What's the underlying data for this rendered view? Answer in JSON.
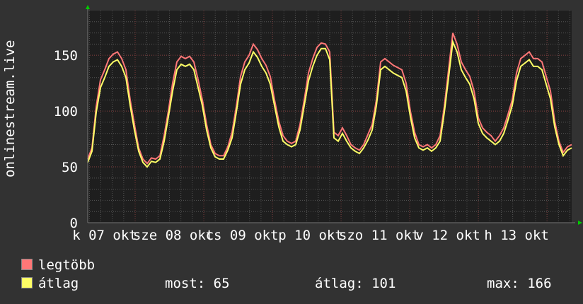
{
  "chart_data": {
    "type": "line",
    "title": "",
    "ylabel": "onlinestream.live",
    "ylim": [
      0,
      190
    ],
    "yticks": [
      "0",
      "50",
      "100",
      "150"
    ],
    "ytick_values": [
      0,
      50,
      100,
      150
    ],
    "xlabels": [
      "k 07 okt",
      "sze 08 okt",
      "cs 09 okt",
      "p 10 okt",
      "szo 11 okt",
      "v 12 okt",
      "h 13 okt"
    ],
    "grid": true,
    "series": [
      {
        "name": "legtöbb",
        "color": "#ff7777",
        "values": [
          57,
          67,
          104,
          128,
          137,
          147,
          151,
          153,
          147,
          137,
          110,
          88,
          67,
          57,
          53,
          58,
          57,
          60,
          78,
          100,
          125,
          144,
          149,
          147,
          149,
          144,
          128,
          110,
          88,
          70,
          62,
          60,
          60,
          68,
          81,
          104,
          131,
          144,
          150,
          160,
          155,
          147,
          141,
          131,
          110,
          91,
          78,
          73,
          71,
          73,
          88,
          110,
          134,
          147,
          157,
          161,
          160,
          153,
          81,
          78,
          85,
          78,
          70,
          67,
          65,
          70,
          79,
          88,
          110,
          144,
          147,
          144,
          141,
          139,
          137,
          125,
          100,
          81,
          70,
          68,
          70,
          67,
          70,
          78,
          104,
          137,
          170,
          160,
          144,
          137,
          131,
          118,
          94,
          85,
          81,
          78,
          73,
          78,
          85,
          97,
          110,
          134,
          147,
          150,
          153,
          147,
          147,
          144,
          131,
          118,
          91,
          73,
          63,
          68,
          70
        ]
      },
      {
        "name": "átlag",
        "color": "#ffff66",
        "values": [
          54,
          64,
          99,
          121,
          130,
          140,
          144,
          146,
          140,
          130,
          105,
          83,
          64,
          54,
          50,
          55,
          54,
          57,
          73,
          95,
          118,
          137,
          142,
          140,
          142,
          137,
          121,
          105,
          83,
          67,
          59,
          57,
          57,
          65,
          76,
          99,
          124,
          137,
          143,
          153,
          148,
          140,
          134,
          124,
          105,
          86,
          73,
          70,
          68,
          70,
          83,
          105,
          127,
          140,
          150,
          156,
          156,
          146,
          76,
          73,
          80,
          73,
          67,
          64,
          62,
          67,
          74,
          83,
          105,
          137,
          140,
          137,
          134,
          132,
          130,
          118,
          95,
          76,
          67,
          65,
          67,
          64,
          67,
          73,
          99,
          130,
          162,
          153,
          137,
          130,
          124,
          111,
          89,
          80,
          76,
          73,
          70,
          73,
          80,
          92,
          105,
          127,
          140,
          143,
          146,
          140,
          140,
          137,
          124,
          111,
          86,
          70,
          60,
          65,
          67
        ]
      }
    ]
  },
  "legend": {
    "max_label": "legtöbb",
    "avg_label": "átlag",
    "now_text": "most: 65",
    "avg_text": "átlag: 101",
    "max_text": "max: 166"
  }
}
